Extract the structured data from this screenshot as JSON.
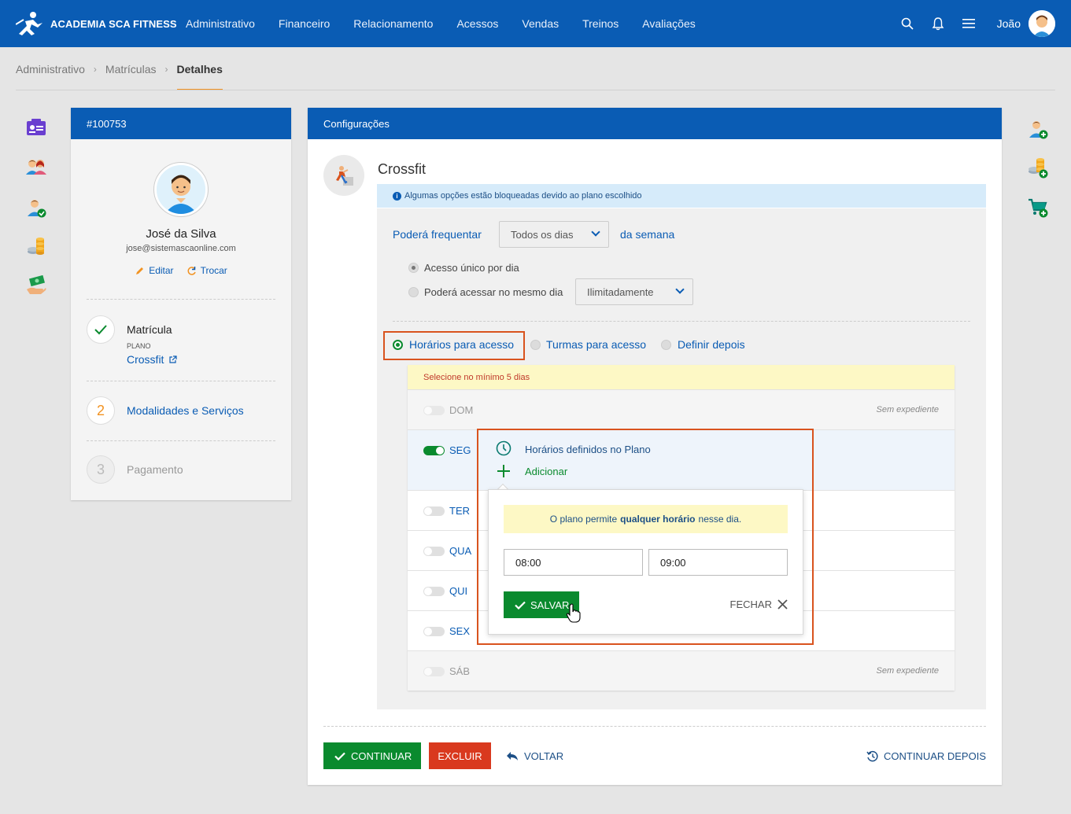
{
  "topbar": {
    "brand": "ACADEMIA SCA FITNESS",
    "nav": [
      "Administrativo",
      "Financeiro",
      "Relacionamento",
      "Acessos",
      "Vendas",
      "Treinos",
      "Avaliações"
    ],
    "icons": [
      "search-icon",
      "bell-icon",
      "menu-icon"
    ],
    "username": "João"
  },
  "breadcrumb": {
    "items": [
      "Administrativo",
      "Matrículas"
    ],
    "current": "Detalhes"
  },
  "left_card": {
    "id": "#100753",
    "name": "José da Silva",
    "email": "jose@sistemascaonline.com",
    "edit_label": "Editar",
    "swap_label": "Trocar",
    "steps": [
      {
        "number": "",
        "title": "Matrícula",
        "sub_label": "PLANO",
        "sub_value": "Crossfit"
      },
      {
        "number": "2",
        "title": "Modalidades e Serviços"
      },
      {
        "number": "3",
        "title": "Pagamento"
      }
    ]
  },
  "main": {
    "header": "Configurações",
    "modality": "Crossfit",
    "info": "Algumas opções estão bloqueadas devido ao plano escolhido",
    "frequency": {
      "label_before": "Poderá frequentar",
      "select_value": "Todos os dias",
      "label_after": "da semana"
    },
    "access_options": {
      "single": "Acesso único por dia",
      "multi": "Poderá acessar no mesmo dia",
      "multi_select": "Ilimitadamente"
    },
    "access_mode": {
      "hours": "Horários para acesso",
      "classes": "Turmas para acesso",
      "later": "Definir depois"
    },
    "warning": "Selecione no mínimo 5 dias",
    "days": [
      {
        "label": "DOM",
        "status": "Sem expediente"
      },
      {
        "label": "SEG"
      },
      {
        "label": "TER"
      },
      {
        "label": "QUA"
      },
      {
        "label": "QUI"
      },
      {
        "label": "SEX"
      },
      {
        "label": "SÁB",
        "status": "Sem expediente"
      }
    ],
    "seg_panel": {
      "defined": "Horários definidos no Plano",
      "add": "Adicionar",
      "note_pre": "O plano permite",
      "note_bold": "qualquer horário",
      "note_post": "nesse dia.",
      "from": "08:00",
      "to": "09:00",
      "save": "SALVAR",
      "close": "FECHAR"
    },
    "footer": {
      "continue": "CONTINUAR",
      "delete": "EXCLUIR",
      "back": "VOLTAR",
      "later": "CONTINUAR DEPOIS"
    }
  },
  "colors": {
    "primary": "#0a5cb4",
    "success": "#0a8a2e",
    "danger": "#d9391e",
    "accent": "#f29322"
  }
}
